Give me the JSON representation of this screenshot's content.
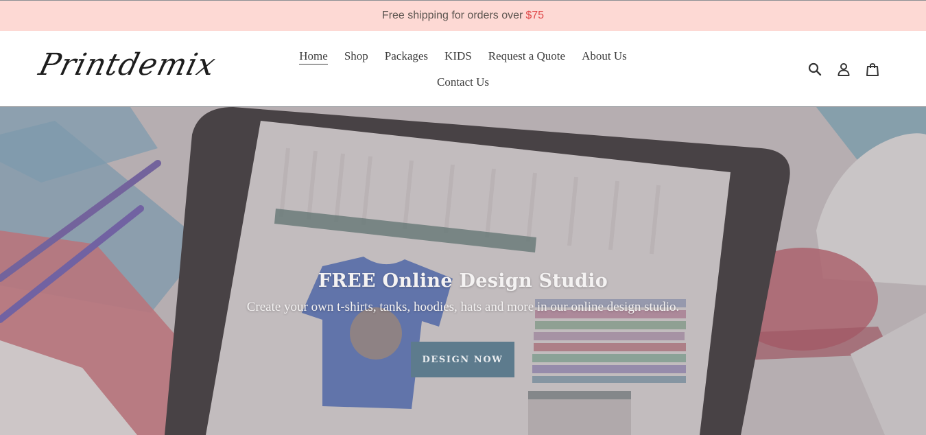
{
  "announcement": {
    "text": "Free shipping for orders over",
    "amount": "$75"
  },
  "header": {
    "logo_text": "Printdemix",
    "nav": [
      {
        "label": "Home",
        "active": true
      },
      {
        "label": "Shop"
      },
      {
        "label": "Packages"
      },
      {
        "label": "KIDS"
      },
      {
        "label": "Request a Quote"
      },
      {
        "label": "About Us"
      },
      {
        "label": "Contact Us"
      }
    ],
    "icons": [
      "search-icon",
      "account-icon",
      "cart-icon"
    ]
  },
  "hero": {
    "title": "FREE Online Design Studio",
    "subtitle": "Create your own t-shirts, tanks, hoodies, hats and more in our online design studio.",
    "button_label": "DESIGN NOW"
  },
  "colors": {
    "announcement_bg": "#fdd9d4",
    "accent": "#e04a4a",
    "button_bg": "#5d7b8d"
  }
}
